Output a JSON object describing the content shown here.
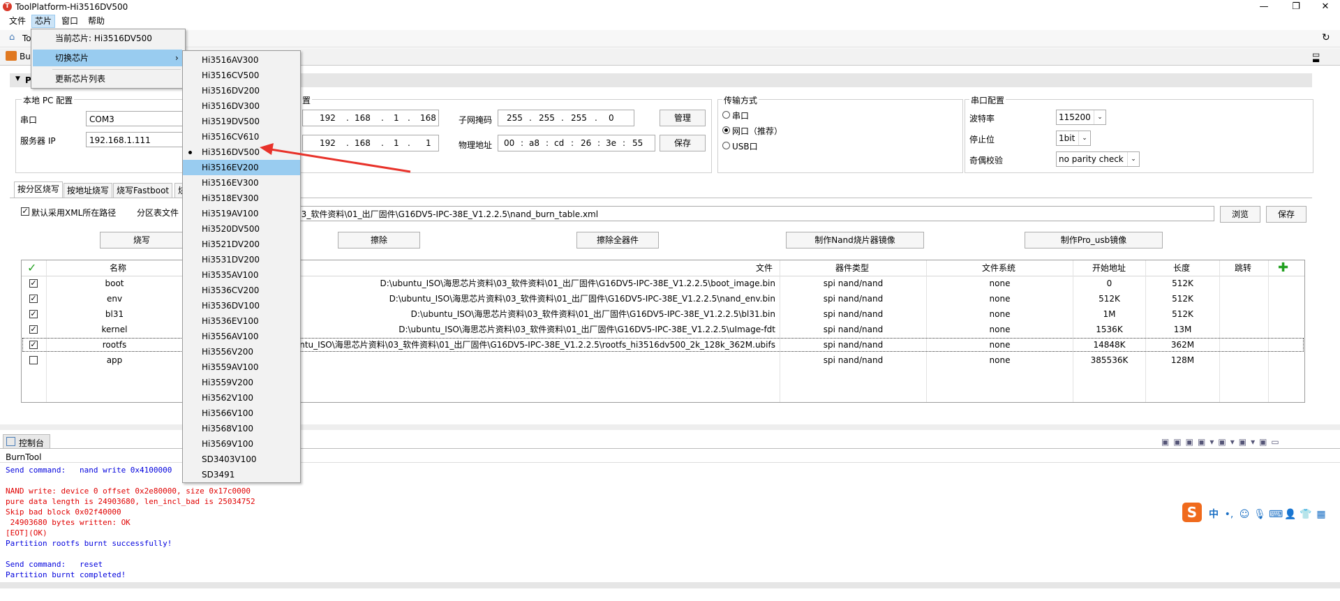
{
  "window": {
    "title": "ToolPlatform-Hi3516DV500",
    "controls": [
      "—",
      "❐",
      "✕"
    ]
  },
  "menubar": [
    "文件",
    "芯片",
    "窗口",
    "帮助"
  ],
  "toolbar": {
    "home_label": "To"
  },
  "tab": {
    "label": "Bu"
  },
  "chip_menu": {
    "current": "当前芯片: Hi3516DV500",
    "switch": "切换芯片",
    "update": "更新芯片列表"
  },
  "chip_list": {
    "selected": "Hi3516DV500",
    "highlighted": "Hi3516EV200",
    "items": [
      "Hi3516AV300",
      "Hi3516CV500",
      "Hi3516DV200",
      "Hi3516DV300",
      "Hi3519DV500",
      "Hi3516CV610",
      "Hi3516DV500",
      "Hi3516EV200",
      "Hi3516EV300",
      "Hi3518EV300",
      "Hi3519AV100",
      "Hi3520DV500",
      "Hi3521DV200",
      "Hi3531DV200",
      "Hi3535AV100",
      "Hi3536CV200",
      "Hi3536DV100",
      "Hi3536EV100",
      "Hi3556AV100",
      "Hi3556V200",
      "Hi3559AV100",
      "Hi3559V200",
      "Hi3562V100",
      "Hi3566V100",
      "Hi3568V100",
      "Hi3569V100",
      "SD3403V100",
      "SD3491"
    ]
  },
  "section": {
    "label": "P"
  },
  "local_pc": {
    "title": "本地 PC 配置",
    "serial_label": "串口",
    "serial_value": "COM3",
    "server_ip_label": "服务器 IP",
    "server_ip_value": "192.168.1.111"
  },
  "board": {
    "title": "置",
    "ip": [
      "192",
      "168",
      "1",
      "168"
    ],
    "gateway": [
      "192",
      "168",
      "1",
      "1"
    ],
    "mask_label": "子网掩码",
    "mask": [
      "255",
      "255",
      "255",
      "0"
    ],
    "mac_label": "物理地址",
    "mac": [
      "00",
      "a8",
      "cd",
      "26",
      "3e",
      "55"
    ],
    "manage_btn": "管理",
    "save_btn": "保存"
  },
  "transfer": {
    "title": "传输方式",
    "options": [
      "串口",
      "网口（推荐）",
      "USB口"
    ],
    "selected": 1
  },
  "serial_cfg": {
    "title": "串口配置",
    "baud_label": "波特率",
    "baud_value": "115200",
    "stop_label": "停止位",
    "stop_value": "1bit",
    "parity_label": "奇偶校验",
    "parity_value": "no parity check"
  },
  "subtabs": [
    "按分区烧写",
    "按地址烧写",
    "烧写Fastboot",
    "烧"
  ],
  "xml": {
    "checkbox_label": "默认采用XML所在路径",
    "partition_label": "分区表文件",
    "path": "\\03_软件资料\\01_出厂固件\\G16DV5-IPC-38E_V1.2.2.5\\nand_burn_table.xml",
    "browse_btn": "浏览",
    "save_btn": "保存"
  },
  "actions": {
    "burn": "烧写",
    "erase": "擦除",
    "erase_all": "擦除全器件",
    "nand_image": "制作Nand烧片器镜像",
    "pro_usb": "制作Pro_usb镜像"
  },
  "table": {
    "headers": [
      "名称",
      "文件",
      "器件类型",
      "文件系统",
      "开始地址",
      "长度",
      "跳转"
    ],
    "rows": [
      {
        "checked": true,
        "name": "boot",
        "file": "D:\\ubuntu_ISO\\海思芯片资料\\03_软件资料\\01_出厂固件\\G16DV5-IPC-38E_V1.2.2.5\\boot_image.bin",
        "type": "spi nand/nand",
        "fs": "none",
        "start": "0",
        "len": "512K"
      },
      {
        "checked": true,
        "name": "env",
        "file": "D:\\ubuntu_ISO\\海思芯片资料\\03_软件资料\\01_出厂固件\\G16DV5-IPC-38E_V1.2.2.5\\nand_env.bin",
        "type": "spi nand/nand",
        "fs": "none",
        "start": "512K",
        "len": "512K"
      },
      {
        "checked": true,
        "name": "bl31",
        "file": "D:\\ubuntu_ISO\\海思芯片资料\\03_软件资料\\01_出厂固件\\G16DV5-IPC-38E_V1.2.2.5\\bl31.bin",
        "type": "spi nand/nand",
        "fs": "none",
        "start": "1M",
        "len": "512K"
      },
      {
        "checked": true,
        "name": "kernel",
        "file": "D:\\ubuntu_ISO\\海思芯片资料\\03_软件资料\\01_出厂固件\\G16DV5-IPC-38E_V1.2.2.5\\uImage-fdt",
        "type": "spi nand/nand",
        "fs": "none",
        "start": "1536K",
        "len": "13M"
      },
      {
        "checked": true,
        "name": "rootfs",
        "file": "ubuntu_ISO\\海思芯片资料\\03_软件资料\\01_出厂固件\\G16DV5-IPC-38E_V1.2.2.5\\rootfs_hi3516dv500_2k_128k_362M.ubifs",
        "type": "spi nand/nand",
        "fs": "none",
        "start": "14848K",
        "len": "362M"
      },
      {
        "checked": false,
        "name": "app",
        "file": "",
        "type": "spi nand/nand",
        "fs": "none",
        "start": "385536K",
        "len": "128M"
      }
    ]
  },
  "console": {
    "tab_label": "控制台",
    "name": "BurnTool",
    "lines": [
      {
        "text": "Send command:   nand write 0x4100000",
        "color": "blue"
      },
      {
        "text": "",
        "color": "blue"
      },
      {
        "text": "NAND write: device 0 offset 0x2e80000, size 0x17c0000",
        "color": "red"
      },
      {
        "text": "pure data length is 24903680, len_incl_bad is 25034752",
        "color": "red"
      },
      {
        "text": "Skip bad block 0x02f40000",
        "color": "red"
      },
      {
        "text": " 24903680 bytes written: OK",
        "color": "red"
      },
      {
        "text": "[EOT](OK)",
        "color": "red"
      },
      {
        "text": "Partition rootfs burnt successfully!",
        "color": "blue"
      },
      {
        "text": "",
        "color": "blue"
      },
      {
        "text": "Send command:   reset",
        "color": "blue"
      },
      {
        "text": "Partition burnt completed!",
        "color": "blue"
      }
    ]
  },
  "ime": {
    "logo": "S",
    "mode": "中"
  },
  "colors": {
    "accent": "#cce4f7",
    "highlight": "#99ccf0",
    "arrow": "#e8322a",
    "console_blue": "#0000dd",
    "console_red": "#e00000"
  }
}
